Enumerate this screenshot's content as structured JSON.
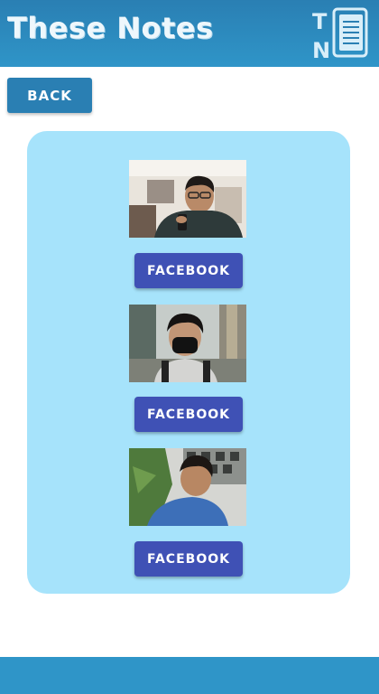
{
  "header": {
    "app_title": "These Notes",
    "logo_letters": [
      "T",
      "N"
    ]
  },
  "back_button": {
    "label": "BACK"
  },
  "profiles": [
    {
      "photo_icon": "person-photo-selfie",
      "facebook_label": "FACEBOOK"
    },
    {
      "photo_icon": "person-photo-masked",
      "facebook_label": "FACEBOOK"
    },
    {
      "photo_icon": "person-photo-outdoor",
      "facebook_label": "FACEBOOK"
    }
  ],
  "colors": {
    "header": "#2a7fb3",
    "card": "#a6e3fb",
    "facebook_button": "#3f51b5",
    "footer": "#2f95c8"
  }
}
